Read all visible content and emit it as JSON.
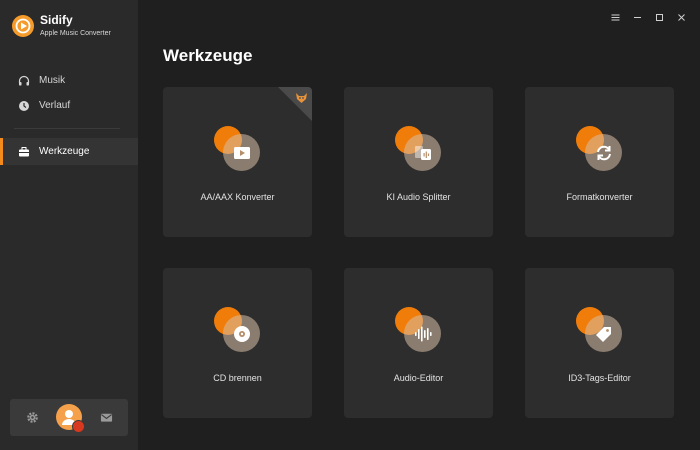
{
  "brand": {
    "name": "Sidify",
    "subtitle": "Apple Music Converter"
  },
  "sidebar": {
    "items": [
      {
        "label": "Musik",
        "icon": "headphones-icon"
      },
      {
        "label": "Verlauf",
        "icon": "clock-icon"
      },
      {
        "label": "Werkzeuge",
        "icon": "toolbox-icon",
        "active": true
      }
    ],
    "footer": {
      "settings_icon": "gear-icon",
      "avatar_icon": "user-avatar",
      "mail_icon": "mail-icon"
    }
  },
  "main": {
    "title": "Werkzeuge",
    "tools": [
      {
        "label": "AA/AAX Konverter",
        "icon": "play-icon",
        "badge": "fox-badge-icon"
      },
      {
        "label": "KI Audio Splitter",
        "icon": "waveform-split-icon"
      },
      {
        "label": "Formatkonverter",
        "icon": "refresh-icon"
      },
      {
        "label": "CD brennen",
        "icon": "disc-icon"
      },
      {
        "label": "Audio-Editor",
        "icon": "waveform-icon"
      },
      {
        "label": "ID3-Tags-Editor",
        "icon": "tag-icon"
      }
    ]
  },
  "colors": {
    "accent": "#f07d0a",
    "sidebar_bg": "#2a2a2a",
    "main_bg": "#1f1f1f",
    "card_bg": "#2d2d2d"
  }
}
